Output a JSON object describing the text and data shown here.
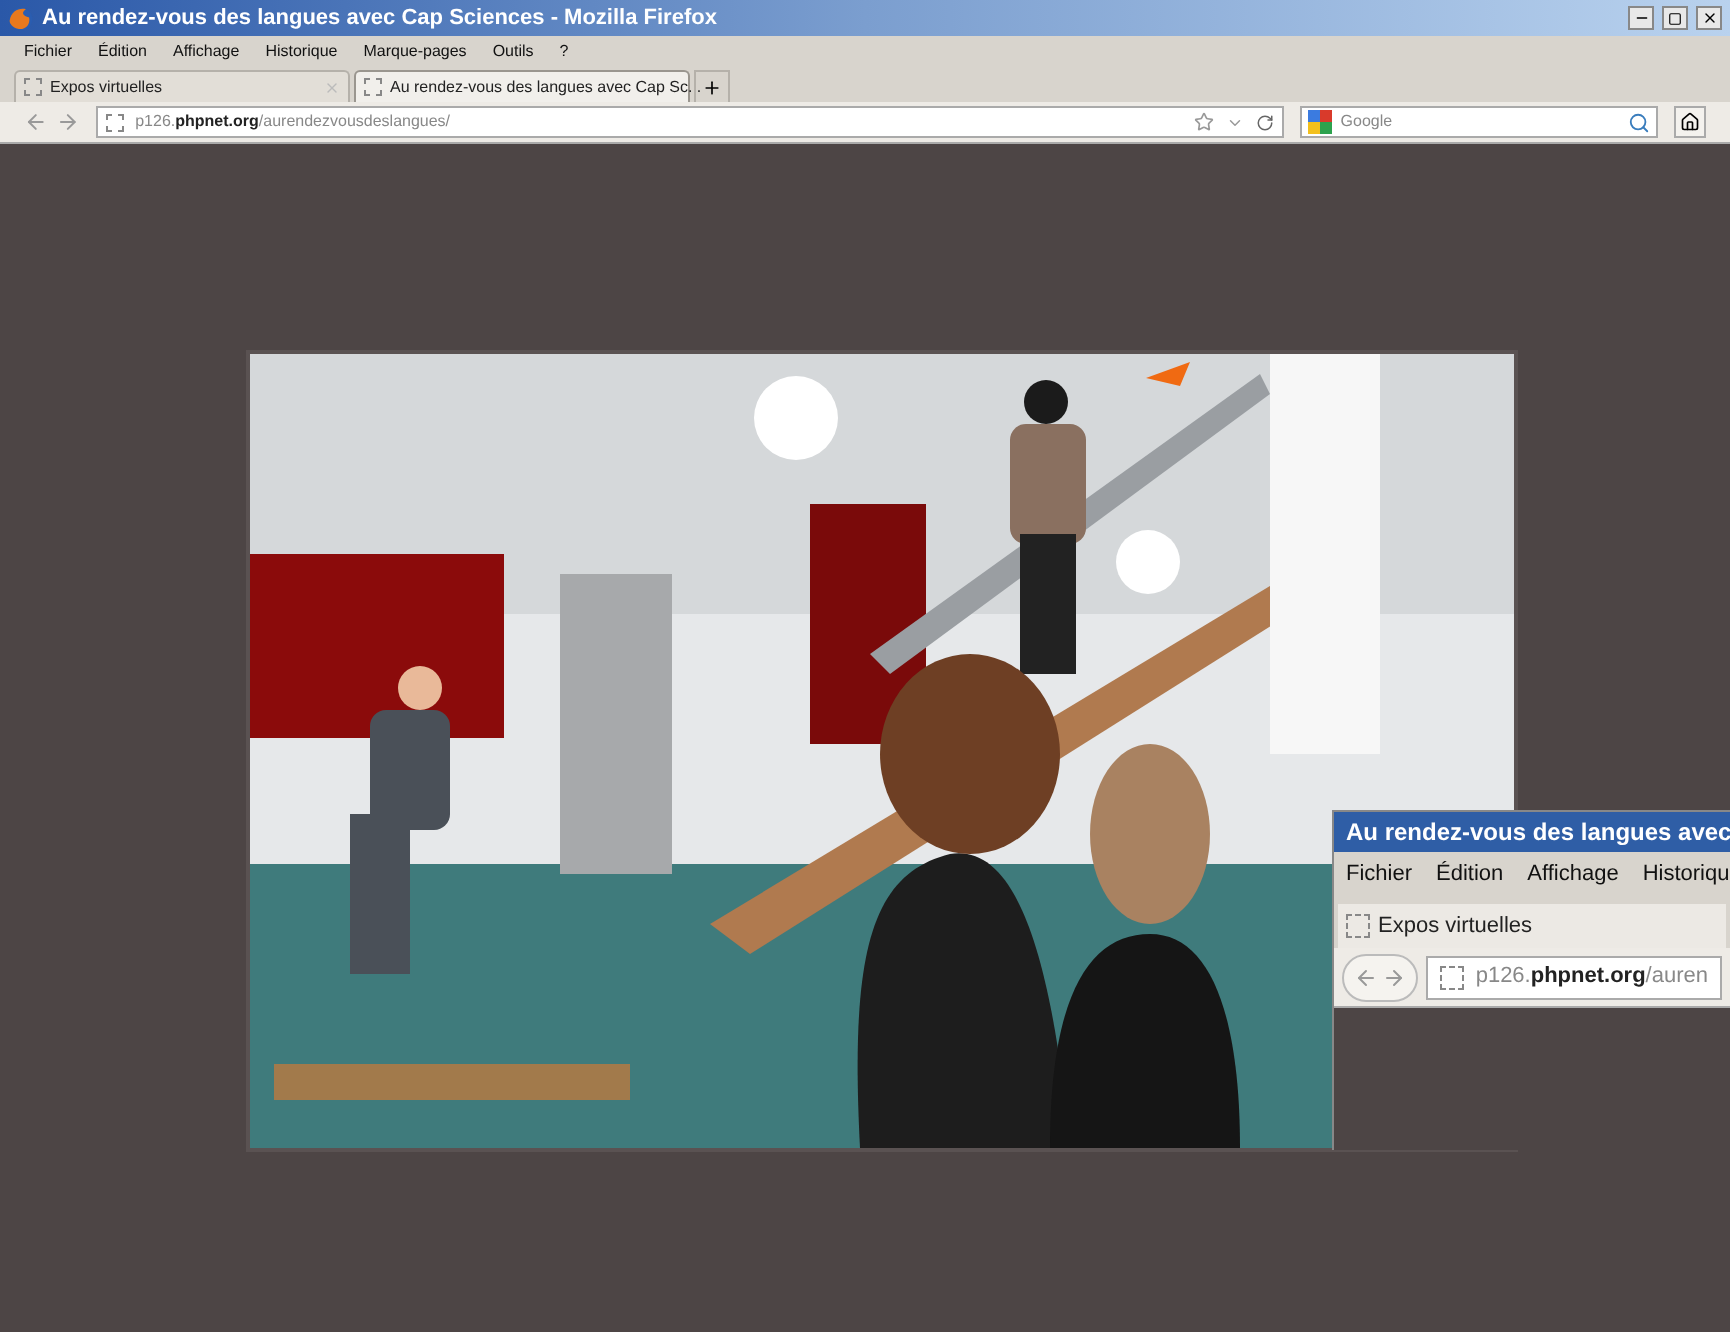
{
  "window": {
    "title": "Au rendez-vous des langues avec Cap Sciences - Mozilla Firefox"
  },
  "menu": [
    "Fichier",
    "Édition",
    "Affichage",
    "Historique",
    "Marque-pages",
    "Outils",
    "?"
  ],
  "tabs": [
    {
      "label": "Expos virtuelles",
      "selected": false
    },
    {
      "label": "Au rendez-vous des langues avec Cap Sc...",
      "selected": true
    }
  ],
  "address_bar": {
    "url": "p126.**phpnet.org**/aurendezvousdeslangues/"
  },
  "search": {
    "placeholder": "Google"
  },
  "overlay_window": {
    "title": "Au rendez-vous des langues avec",
    "menu": [
      "Fichier",
      "Édition",
      "Affichage",
      "Historiqu"
    ],
    "tabs": [
      {
        "label": "Expos virtuelles",
        "selected": true
      }
    ],
    "url": "p126.**phpnet.org**/auren"
  }
}
